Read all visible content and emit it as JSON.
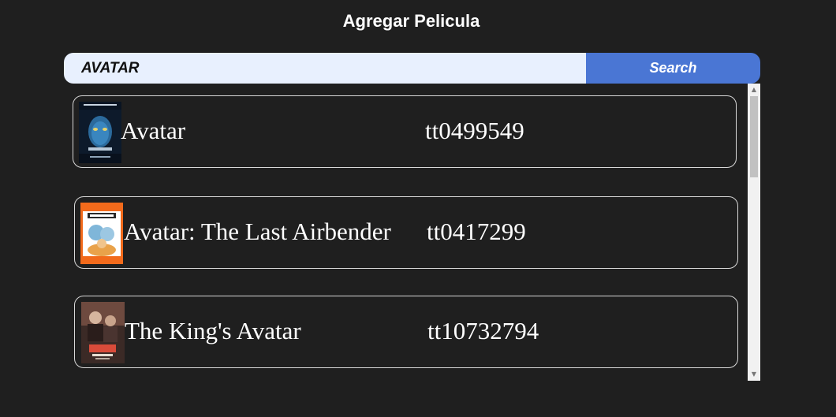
{
  "page": {
    "title": "Agregar Pelicula"
  },
  "search": {
    "value": "AVATAR",
    "button_label": "Search"
  },
  "results": [
    {
      "title": "Avatar",
      "id": "tt0499549",
      "poster_icon": "avatar-poster"
    },
    {
      "title": "Avatar: The Last Airbender",
      "id": "tt0417299",
      "poster_icon": "last-airbender-poster"
    },
    {
      "title": "The King's Avatar",
      "id": "tt10732794",
      "poster_icon": "kings-avatar-poster"
    }
  ],
  "colors": {
    "background": "#1f1f1f",
    "search_input": "#e8f0fe",
    "search_button": "#4a76d4",
    "text": "#ffffff"
  }
}
